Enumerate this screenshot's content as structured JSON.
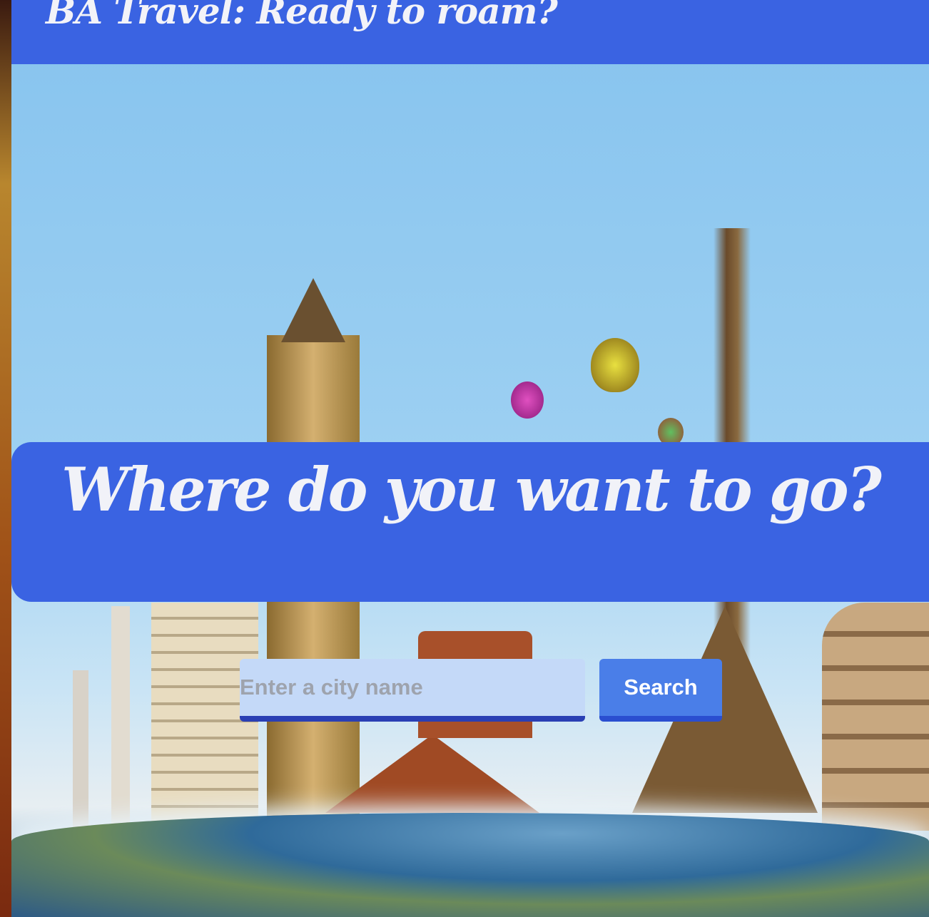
{
  "header": {
    "title": "BA Travel: Ready to roam?"
  },
  "hero": {
    "heading": "Where do you want to go?"
  },
  "search": {
    "placeholder": "Enter a city name",
    "button_label": "Search"
  },
  "colors": {
    "primary": "#3a63e2",
    "input_bg": "#c4d9f8",
    "button": "#4a7ee8"
  }
}
